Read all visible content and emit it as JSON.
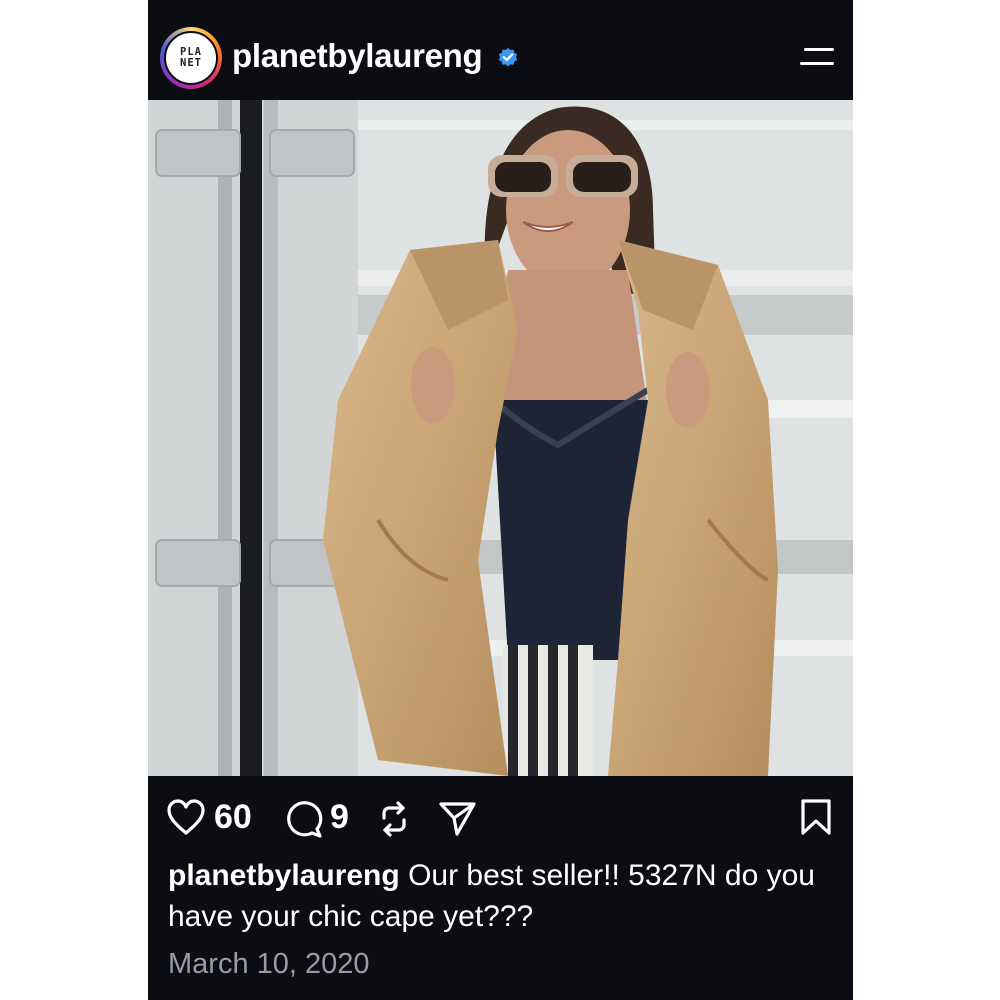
{
  "header": {
    "avatar_text": [
      "PLA",
      "NET"
    ],
    "username": "planetbylaureng",
    "verified": true,
    "menu_icon": "menu-icon"
  },
  "actions": {
    "likes": "60",
    "comments": "9",
    "icons": [
      "heart-icon",
      "comment-icon",
      "repost-icon",
      "share-icon",
      "bookmark-icon"
    ]
  },
  "caption": {
    "username": "planetbylaureng",
    "text": "Our best seller!! 5327N do you have your chic cape yet???"
  },
  "date": "March 10, 2020",
  "colors": {
    "background": "#0c0d12",
    "text": "#ffffff",
    "muted": "#9a9ba3",
    "verified": "#3897f0"
  }
}
